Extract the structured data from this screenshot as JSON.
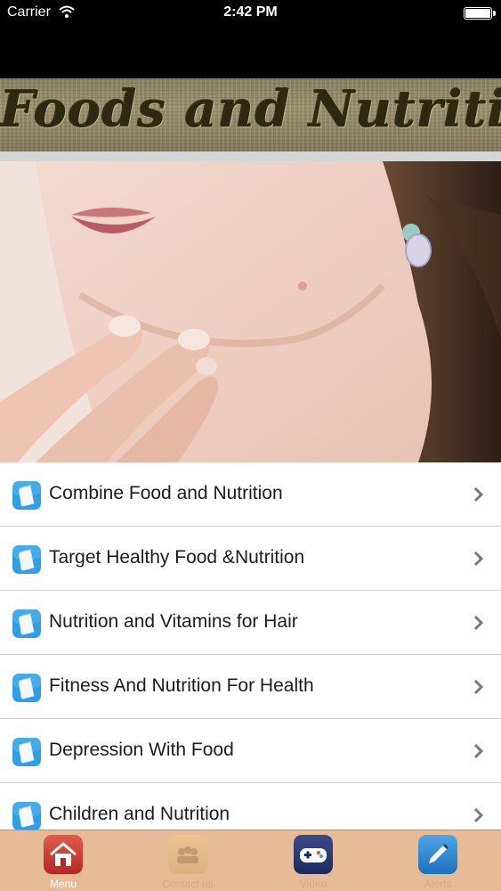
{
  "status_bar": {
    "carrier": "Carrier",
    "time": "2:42 PM",
    "wifi_icon": "wifi-icon",
    "battery_icon": "battery-icon"
  },
  "banner": {
    "title": "Foods and Nutrition"
  },
  "hero": {
    "icon": "hero-photo-woman-chin"
  },
  "menu": {
    "items": [
      {
        "label": "Combine Food and Nutrition"
      },
      {
        "label": "Target Healthy Food &Nutrition"
      },
      {
        "label": "Nutrition and Vitamins for Hair"
      },
      {
        "label": "Fitness And Nutrition For Health"
      },
      {
        "label": "Depression With Food"
      },
      {
        "label": "Children and Nutrition"
      }
    ],
    "item_icon": "document-icon",
    "chevron_icon": "chevron-right-icon"
  },
  "tab_bar": {
    "tabs": [
      {
        "label": "Menu",
        "icon": "home-icon",
        "active": true
      },
      {
        "label": "Contact us",
        "icon": "contact-icon",
        "active": false
      },
      {
        "label": "Video",
        "icon": "gamepad-icon",
        "active": false
      },
      {
        "label": "Alerts",
        "icon": "pen-icon",
        "active": false
      }
    ]
  },
  "colors": {
    "tab_bar_bg": "#e8bb97",
    "status_bar_bg": "#000000",
    "item_icon_blue": "#2f9ee6"
  }
}
